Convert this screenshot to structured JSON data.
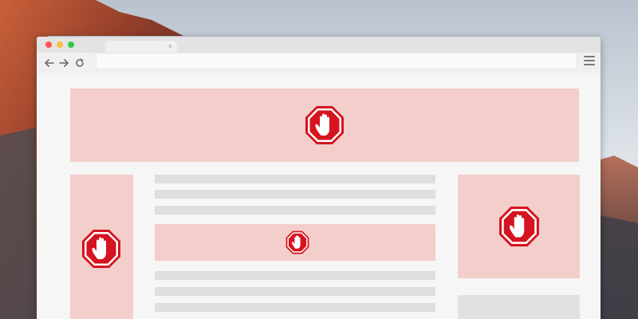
{
  "browser": {
    "tab_close_glyph": "×",
    "nav_back": "back-arrow-icon",
    "nav_forward": "forward-arrow-icon",
    "nav_reload": "reload-icon",
    "menu_icon": "hamburger-menu-icon"
  },
  "colors": {
    "ad_placeholder": "#f4ceca",
    "stop_sign_red": "#d5141f",
    "content_line": "#dedede",
    "traffic_light_close": "#fc5753",
    "traffic_light_minimize": "#fdbc40",
    "traffic_light_zoom": "#33c748"
  },
  "ad_blocks": {
    "icon": "adblock-stop-hand-icon",
    "count": 4
  }
}
